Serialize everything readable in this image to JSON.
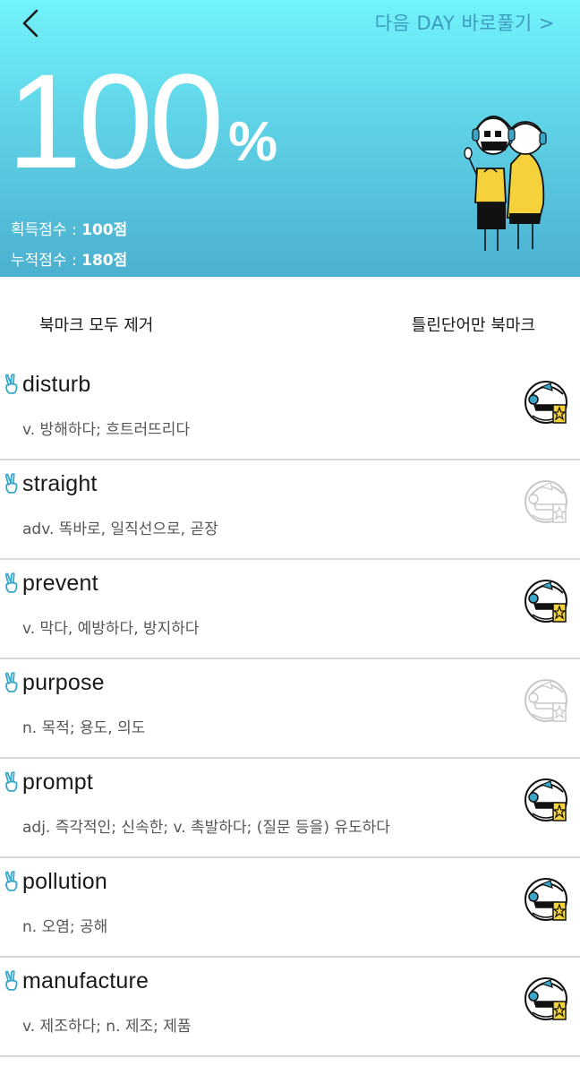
{
  "header": {
    "back_icon": "chevron-left-icon",
    "next_link": "다음 DAY 바로풀기 >",
    "score_value": "100",
    "score_unit": "%",
    "earned_label": "획득점수 : ",
    "earned_value": "100점",
    "total_label": "누적점수 : ",
    "total_value": "180점"
  },
  "actions": {
    "remove_all": "북마크 모두 제거",
    "wrong_only": "틀린단어만 북마크"
  },
  "colors": {
    "header_top": "#72f3fb",
    "header_bottom": "#4bb0cf",
    "accent": "#3aa7c9",
    "star": "#f4d43a"
  },
  "words": [
    {
      "word": "disturb",
      "meaning": "v. 방해하다; 흐트러뜨리다",
      "bookmarked": true
    },
    {
      "word": "straight",
      "meaning": "adv. 똑바로, 일직선으로, 곧장",
      "bookmarked": false
    },
    {
      "word": "prevent",
      "meaning": "v. 막다, 예방하다, 방지하다",
      "bookmarked": true
    },
    {
      "word": "purpose",
      "meaning": "n. 목적; 용도, 의도",
      "bookmarked": false
    },
    {
      "word": "prompt",
      "meaning": "adj. 즉각적인; 신속한; v. 촉발하다; (질문 등을) 유도하다",
      "bookmarked": true
    },
    {
      "word": "pollution",
      "meaning": "n. 오염; 공해",
      "bookmarked": true
    },
    {
      "word": "manufacture",
      "meaning": "v. 제조하다; n. 제조; 제품",
      "bookmarked": true
    }
  ]
}
